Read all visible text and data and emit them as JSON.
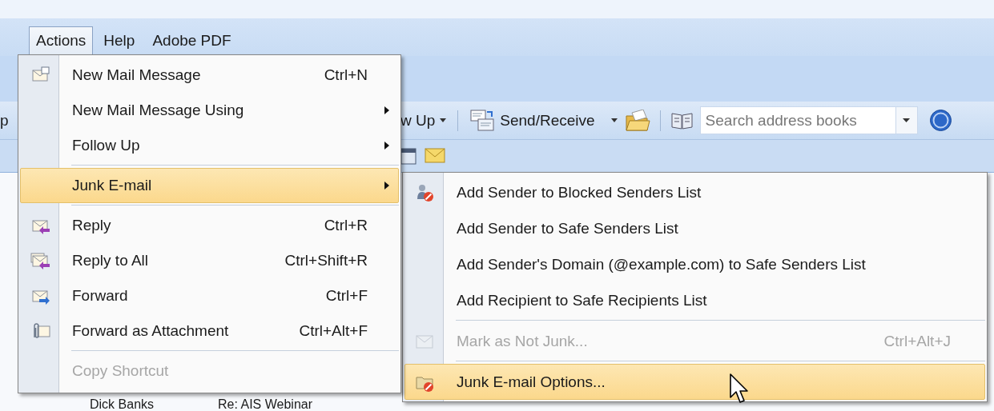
{
  "menu_bar": [
    {
      "label": "Actions",
      "selected": true
    },
    {
      "label": "Help",
      "selected": false
    },
    {
      "label": "Adobe PDF",
      "selected": false
    }
  ],
  "toolbar": {
    "cut_label": "p",
    "follow_up": "w Up",
    "send_receive": "Send/Receive",
    "search": {
      "placeholder": "Search address books"
    }
  },
  "actions_menu": [
    {
      "kind": "item",
      "label": "New Mail Message",
      "shortcut": "Ctrl+N",
      "submenu_arrow": false,
      "selected": false,
      "disabled": false
    },
    {
      "kind": "item",
      "label": "New Mail Message Using",
      "submenu_arrow": true,
      "selected": false,
      "disabled": false
    },
    {
      "kind": "item",
      "label": "Follow Up",
      "submenu_arrow": true,
      "selected": false,
      "disabled": false
    },
    {
      "kind": "separator"
    },
    {
      "kind": "item",
      "label": "Junk E-mail",
      "submenu_arrow": true,
      "selected": true,
      "disabled": false,
      "children": [
        {
          "kind": "item",
          "label": "Add Sender to Blocked Senders List",
          "selected": false,
          "disabled": false
        },
        {
          "kind": "item",
          "label": "Add Sender to Safe Senders List",
          "selected": false,
          "disabled": false
        },
        {
          "kind": "item",
          "label": "Add Sender's Domain (@example.com) to Safe Senders List",
          "selected": false,
          "disabled": false
        },
        {
          "kind": "item",
          "label": "Add Recipient to Safe Recipients List",
          "selected": false,
          "disabled": false
        },
        {
          "kind": "separator"
        },
        {
          "kind": "item",
          "label": "Mark as Not Junk...",
          "shortcut": "Ctrl+Alt+J",
          "selected": false,
          "disabled": true
        },
        {
          "kind": "separator"
        },
        {
          "kind": "item",
          "label": "Junk E-mail Options...",
          "selected": true,
          "disabled": false
        }
      ]
    },
    {
      "kind": "separator"
    },
    {
      "kind": "item",
      "label": "Reply",
      "shortcut": "Ctrl+R",
      "submenu_arrow": false,
      "selected": false,
      "disabled": false
    },
    {
      "kind": "item",
      "label": "Reply to All",
      "shortcut": "Ctrl+Shift+R",
      "submenu_arrow": false,
      "selected": false,
      "disabled": false
    },
    {
      "kind": "item",
      "label": "Forward",
      "shortcut": "Ctrl+F",
      "submenu_arrow": false,
      "selected": false,
      "disabled": false
    },
    {
      "kind": "item",
      "label": "Forward as Attachment",
      "shortcut": "Ctrl+Alt+F",
      "submenu_arrow": false,
      "selected": false,
      "disabled": false
    },
    {
      "kind": "separator"
    },
    {
      "kind": "item",
      "label": "Copy Shortcut",
      "submenu_arrow": false,
      "selected": false,
      "disabled": true
    }
  ],
  "message_list": [
    {
      "from": "Dick Banks",
      "subject": "Re: AIS Webinar"
    }
  ]
}
